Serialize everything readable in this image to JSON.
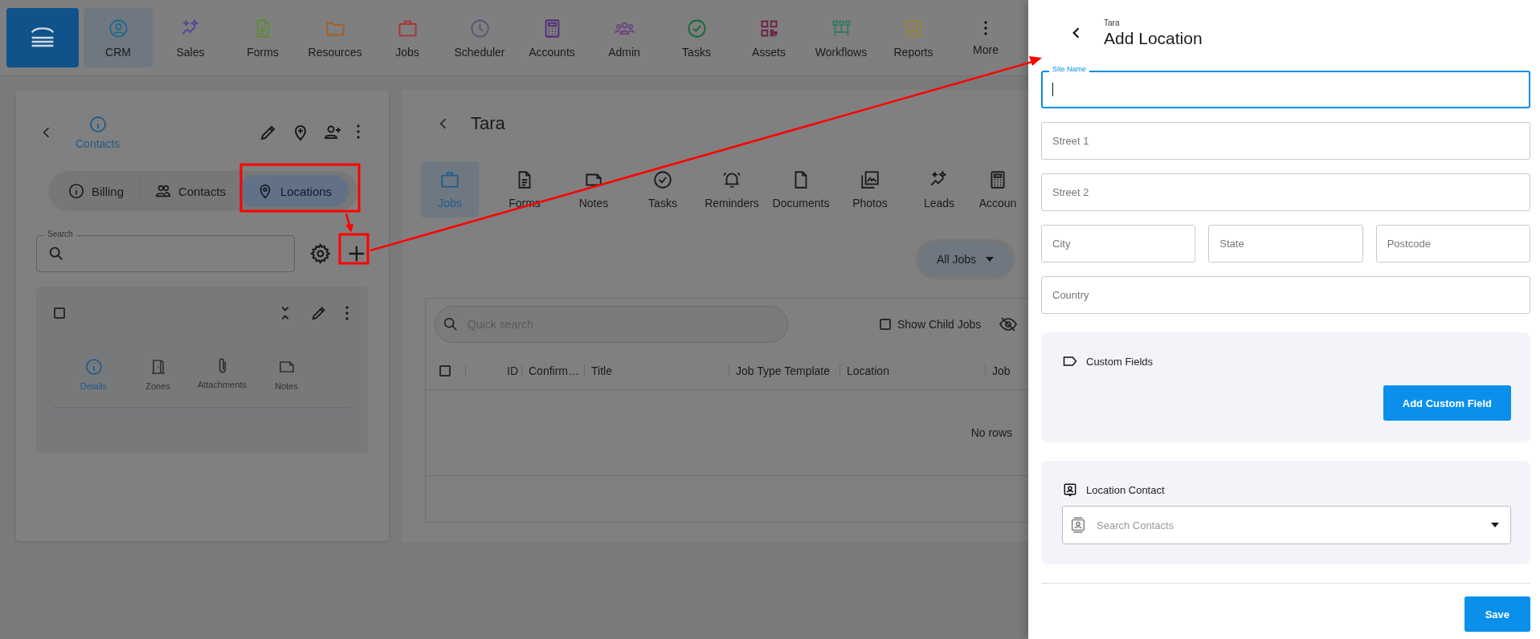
{
  "nav": {
    "items": [
      {
        "label": "CRM",
        "color": "#2c6a86",
        "selected": true
      },
      {
        "label": "Sales",
        "color": "#4d4d99",
        "selected": false
      },
      {
        "label": "Forms",
        "color": "#5f8a3a",
        "selected": false
      },
      {
        "label": "Resources",
        "color": "#a0612c",
        "selected": false
      },
      {
        "label": "Jobs",
        "color": "#a33a3a",
        "selected": false
      },
      {
        "label": "Scheduler",
        "color": "#5e5a70",
        "selected": false
      },
      {
        "label": "Accounts",
        "color": "#53327a",
        "selected": false
      },
      {
        "label": "Admin",
        "color": "#6a4680",
        "selected": false
      },
      {
        "label": "Tasks",
        "color": "#1f6b3c",
        "selected": false
      },
      {
        "label": "Assets",
        "color": "#6a2447",
        "selected": false
      },
      {
        "label": "Workflows",
        "color": "#3a7a60",
        "selected": false
      },
      {
        "label": "Reports",
        "color": "#9c8236",
        "selected": false
      },
      {
        "label": "More",
        "color": "#111111",
        "selected": false
      }
    ]
  },
  "contact_panel": {
    "title": "Contacts",
    "tabs": [
      {
        "label": "Billing",
        "selected": false
      },
      {
        "label": "Contacts",
        "selected": false
      },
      {
        "label": "Locations",
        "selected": true
      }
    ],
    "search": {
      "label": "Search"
    },
    "card": {
      "checked": false,
      "tabs": [
        {
          "label": "Details",
          "selected": true
        },
        {
          "label": "Zones",
          "selected": false
        },
        {
          "label": "Attachments",
          "selected": false
        },
        {
          "label": "Notes",
          "selected": false
        }
      ]
    }
  },
  "customer_panel": {
    "title": "Tara",
    "tabs": [
      {
        "label": "Jobs",
        "selected": true
      },
      {
        "label": "Forms",
        "selected": false
      },
      {
        "label": "Notes",
        "selected": false
      },
      {
        "label": "Tasks",
        "selected": false
      },
      {
        "label": "Reminders",
        "selected": false
      },
      {
        "label": "Documents",
        "selected": false
      },
      {
        "label": "Photos",
        "selected": false
      },
      {
        "label": "Leads",
        "selected": false
      },
      {
        "label": "Accoun",
        "selected": false
      }
    ],
    "filter": "All Jobs",
    "quick_search": {
      "placeholder": "Quick search"
    },
    "show_child_jobs": {
      "label": "Show Child Jobs",
      "checked": false
    },
    "table": {
      "select_all": false,
      "columns": [
        "ID",
        "Confirm…",
        "Title",
        "Job Type Template",
        "Location",
        "Job"
      ],
      "empty_text": "No rows"
    }
  },
  "drawer": {
    "subtitle": "Tara",
    "title": "Add Location",
    "rows": [
      [
        {
          "label": "Site Name",
          "focused": true
        }
      ],
      [
        {
          "placeholder": "Street 1",
          "focused": false
        }
      ],
      [
        {
          "placeholder": "Street 2",
          "focused": false
        }
      ],
      [
        {
          "placeholder": "City",
          "focused": false
        },
        {
          "placeholder": "State",
          "focused": false
        },
        {
          "placeholder": "Postcode",
          "focused": false
        }
      ],
      [
        {
          "placeholder": "Country",
          "focused": false
        }
      ]
    ],
    "custom_fields": {
      "title": "Custom Fields",
      "button": "Add Custom Field"
    },
    "location_contact": {
      "title": "Location Contact",
      "placeholder": "Search Contacts"
    },
    "save": "Save"
  }
}
